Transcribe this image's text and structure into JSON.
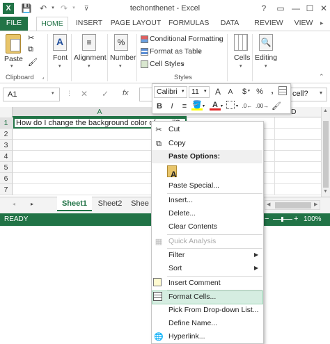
{
  "app": {
    "title": "techonthenet - Excel",
    "window_buttons": [
      "?",
      "▭",
      "—",
      "☐",
      "✕"
    ]
  },
  "tabs": [
    "FILE",
    "HOME",
    "INSERT",
    "PAGE LAYOUT",
    "FORMULAS",
    "DATA",
    "REVIEW",
    "VIEW"
  ],
  "ribbon": {
    "paste": "Paste",
    "font": "Font",
    "alignment": "Alignment",
    "number": "Number",
    "conditional_formatting": "Conditional Formatting",
    "format_as_table": "Format as Table",
    "cell_styles": "Cell Styles",
    "cells": "Cells",
    "editing": "Editing",
    "groups": {
      "clipboard": "Clipboard",
      "styles": "Styles"
    }
  },
  "formula_bar": {
    "name_box": "A1",
    "fx": "fx",
    "visible_text": "cell?"
  },
  "mini_toolbar": {
    "font": "Calibri",
    "size": "11",
    "inc_font": "A",
    "dec_font": "A",
    "currency": "$",
    "percent": "%",
    "comma": ",",
    "bold": "B",
    "italic": "I"
  },
  "grid": {
    "columns": [
      "A",
      "D"
    ],
    "rows": [
      "1",
      "2",
      "3",
      "4",
      "5",
      "6",
      "7"
    ],
    "cell_a1": "How do I change the background color of a cell?"
  },
  "sheets": [
    "Sheet1",
    "Sheet2",
    "Shee"
  ],
  "status": {
    "ready": "READY",
    "zoom": "100%"
  },
  "context_menu": {
    "cut": "Cut",
    "copy": "Copy",
    "paste_options": "Paste Options:",
    "paste_special": "Paste Special...",
    "insert": "Insert...",
    "delete": "Delete...",
    "clear_contents": "Clear Contents",
    "quick_analysis": "Quick Analysis",
    "filter": "Filter",
    "sort": "Sort",
    "insert_comment": "Insert Comment",
    "format_cells": "Format Cells...",
    "pick_list": "Pick From Drop-down List...",
    "define_name": "Define Name...",
    "hyperlink": "Hyperlink..."
  },
  "colors": {
    "excel_green": "#217346",
    "highlight": "#d5ede1",
    "grid": "#e1e1e1"
  }
}
